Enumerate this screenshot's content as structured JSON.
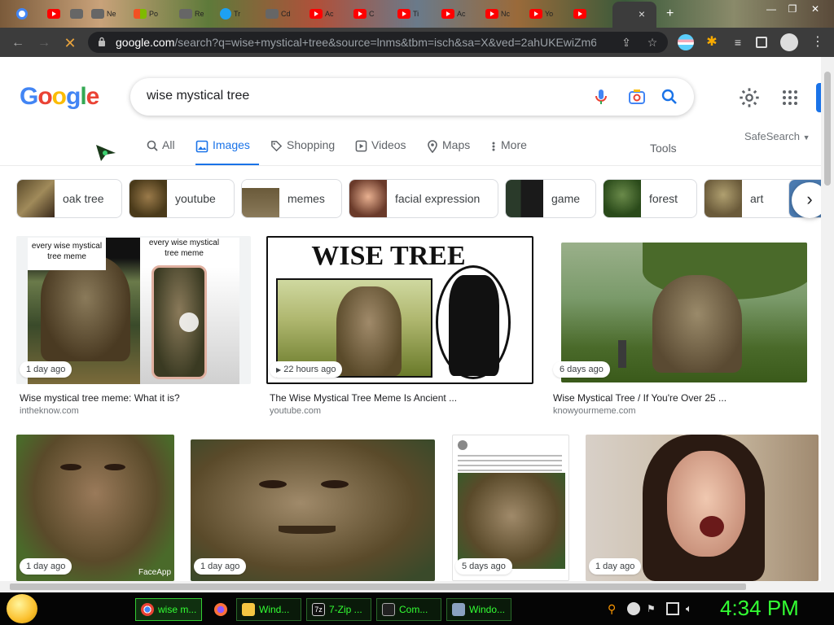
{
  "browser": {
    "tabs": [
      {
        "title": "",
        "icon": "google-icon"
      },
      {
        "title": "",
        "icon": "youtube-icon"
      },
      {
        "title": "",
        "icon": "speaker-icon"
      },
      {
        "title": "Ne",
        "icon": "site-icon"
      },
      {
        "title": "Po",
        "icon": "microsoft-icon"
      },
      {
        "title": "Re",
        "icon": "site-icon"
      },
      {
        "title": "Tr",
        "icon": "twitter-icon"
      },
      {
        "title": "Cd",
        "icon": "site-icon"
      },
      {
        "title": "Ac",
        "icon": "youtube-icon"
      },
      {
        "title": "C",
        "icon": "youtube-icon"
      },
      {
        "title": "Ti",
        "icon": "youtube-icon"
      },
      {
        "title": "Ac",
        "icon": "youtube-icon"
      },
      {
        "title": "Nc",
        "icon": "youtube-icon"
      },
      {
        "title": "Yo",
        "icon": "youtube-icon"
      },
      {
        "title": "",
        "icon": "youtube-icon"
      }
    ],
    "active_tab_close": "×",
    "new_tab": "+",
    "url_host": "google.com",
    "url_path": "/search?q=wise+mystical+tree&source=lnms&tbm=isch&sa=X&ved=2ahUKEwiZm6..."
  },
  "google": {
    "logo": [
      "G",
      "o",
      "o",
      "g",
      "l",
      "e"
    ],
    "logo_colors": [
      "#4285F4",
      "#EA4335",
      "#FBBC05",
      "#4285F4",
      "#34A853",
      "#EA4335"
    ],
    "query": "wise mystical tree",
    "tabs": [
      {
        "label": "All",
        "icon": "search-icon"
      },
      {
        "label": "Images",
        "icon": "image-icon",
        "active": true
      },
      {
        "label": "Shopping",
        "icon": "tag-icon"
      },
      {
        "label": "Videos",
        "icon": "play-icon"
      },
      {
        "label": "Maps",
        "icon": "pin-icon"
      },
      {
        "label": "More",
        "icon": "dots-vertical-icon"
      }
    ],
    "tools": "Tools",
    "safesearch": "SafeSearch",
    "chips": [
      "oak tree",
      "youtube",
      "memes",
      "facial expression",
      "game",
      "forest",
      "art"
    ],
    "results_row1": [
      {
        "title": "Wise mystical tree meme: What it is?",
        "source": "intheknow.com",
        "badge": "1 day ago",
        "caption_left": "every wise mystical tree meme",
        "caption_right": "every wise mystical tree meme"
      },
      {
        "title": "The Wise Mystical Tree Meme Is Ancient ...",
        "source": "youtube.com",
        "badge": "22 hours ago",
        "banner": "WISE TREE"
      },
      {
        "title": "Wise Mystical Tree / If You're Over 25 ...",
        "source": "knowyourmeme.com",
        "badge": "6 days ago"
      }
    ],
    "results_row2": [
      {
        "badge": "1 day ago",
        "watermark": "FaceApp"
      },
      {
        "badge": "1 day ago"
      },
      {
        "badge": "5 days ago"
      },
      {
        "badge": "1 day ago"
      }
    ]
  },
  "taskbar": {
    "tasks": [
      "wise m...",
      "",
      "Wind...",
      "7-Zip ...",
      "Com...",
      "Windo..."
    ],
    "clock": "4:34 PM"
  },
  "colors": {
    "accent": "#1a73e8",
    "taskbar_text": "#33ff33"
  }
}
